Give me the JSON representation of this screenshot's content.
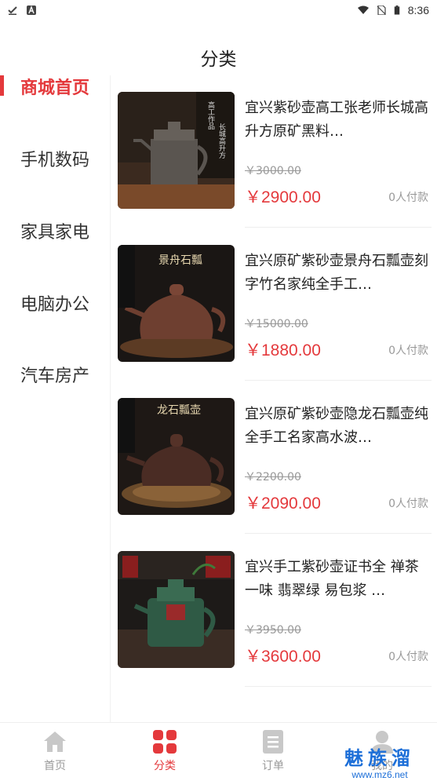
{
  "status_bar": {
    "time": "8:36",
    "icons": [
      "check-download-icon",
      "a-badge-icon",
      "wifi-icon",
      "no-sim-icon",
      "battery-icon"
    ]
  },
  "header": {
    "title": "分类"
  },
  "sidebar": {
    "items": [
      {
        "label": "商城首页",
        "active": true
      },
      {
        "label": "手机数码",
        "active": false
      },
      {
        "label": "家具家电",
        "active": false
      },
      {
        "label": "电脑办公",
        "active": false
      },
      {
        "label": "汽车房产",
        "active": false
      }
    ]
  },
  "products": [
    {
      "title": "宜兴紫砂壶高工张老师长城高升方原矿黑料…",
      "original_price": "￥3000.00",
      "price": "￥2900.00",
      "sold": "0人付款",
      "image_text": "高工作品 长城高升方",
      "image_colors": {
        "bg": "#3b2a1f",
        "pot": "#5a5550"
      }
    },
    {
      "title": "宜兴原矿紫砂壶景舟石瓢壶刻字竹名家纯全手工…",
      "original_price": "￥15000.00",
      "price": "￥1880.00",
      "sold": "0人付款",
      "image_text": "景舟石瓢",
      "image_colors": {
        "bg": "#1a1614",
        "pot": "#6e3f30"
      }
    },
    {
      "title": "宜兴原矿紫砂壶隐龙石瓢壶纯全手工名家高水波…",
      "original_price": "￥2200.00",
      "price": "￥2090.00",
      "sold": "0人付款",
      "image_text": "龙石瓢壶",
      "image_colors": {
        "bg": "#1e1815",
        "pot": "#4a2c24"
      }
    },
    {
      "title": "宜兴手工紫砂壶证书全 禅茶一味 翡翠绿 易包浆 …",
      "original_price": "￥3950.00",
      "price": "￥3600.00",
      "sold": "0人付款",
      "image_text": "",
      "image_colors": {
        "bg": "#1d1a18",
        "pot": "#2f5a45"
      }
    }
  ],
  "tabbar": {
    "tabs": [
      {
        "label": "首页",
        "icon": "home-icon",
        "active": false
      },
      {
        "label": "分类",
        "icon": "category-grid-icon",
        "active": true
      },
      {
        "label": "订单",
        "icon": "order-list-icon",
        "active": false
      },
      {
        "label": "我的",
        "icon": "user-icon",
        "active": false
      }
    ]
  },
  "watermark": {
    "text": "魅族溜",
    "url": "www.mz6.net"
  },
  "colors": {
    "accent": "#e4393c",
    "muted": "#999999"
  }
}
